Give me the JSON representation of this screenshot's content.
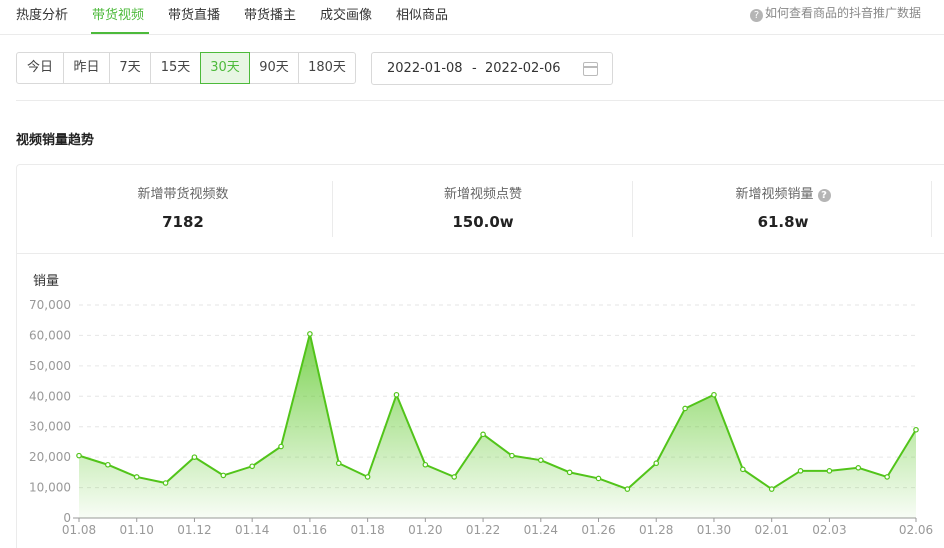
{
  "tabs": [
    {
      "label": "热度分析"
    },
    {
      "label": "带货视频"
    },
    {
      "label": "带货直播"
    },
    {
      "label": "带货播主"
    },
    {
      "label": "成交画像"
    },
    {
      "label": "相似商品"
    }
  ],
  "help_text": "如何查看商品的抖音推广数据",
  "ranges": [
    "今日",
    "昨日",
    "7天",
    "15天",
    "30天",
    "90天",
    "180天"
  ],
  "active_range": "30天",
  "date_range": {
    "start": "2022-01-08",
    "separator": "-",
    "end": "2022-02-06"
  },
  "section_title": "视频销量趋势",
  "stats": [
    {
      "label": "新增带货视频数",
      "value": "7182"
    },
    {
      "label": "新增视频点赞",
      "value": "150.0w"
    },
    {
      "label": "新增视频销量",
      "value": "61.8w"
    }
  ],
  "chart_data": {
    "type": "area",
    "ylabel": "销量",
    "ylim": [
      0,
      70000
    ],
    "yticks": [
      "0",
      "10,000",
      "20,000",
      "30,000",
      "40,000",
      "50,000",
      "60,000",
      "70,000"
    ],
    "grid": true,
    "color": "#52c41a",
    "x": [
      "01.08",
      "01.09",
      "01.10",
      "01.11",
      "01.12",
      "01.13",
      "01.14",
      "01.15",
      "01.16",
      "01.17",
      "01.18",
      "01.19",
      "01.20",
      "01.21",
      "01.22",
      "01.23",
      "01.24",
      "01.25",
      "01.26",
      "01.27",
      "01.28",
      "01.29",
      "01.30",
      "01.31",
      "02.01",
      "02.02",
      "02.03",
      "02.04",
      "02.05",
      "02.06"
    ],
    "xtick_labels": [
      "01.08",
      "01.10",
      "01.12",
      "01.14",
      "01.16",
      "01.18",
      "01.20",
      "01.22",
      "01.24",
      "01.26",
      "01.28",
      "01.30",
      "02.01",
      "02.03",
      "02.06"
    ],
    "values": [
      20500,
      17500,
      13500,
      11500,
      20000,
      14000,
      17000,
      23500,
      60500,
      18000,
      13500,
      40500,
      17500,
      13500,
      27500,
      20500,
      19000,
      15000,
      13000,
      9500,
      18000,
      36000,
      40500,
      16000,
      9500,
      15500,
      15500,
      16500,
      13500,
      29000
    ]
  }
}
